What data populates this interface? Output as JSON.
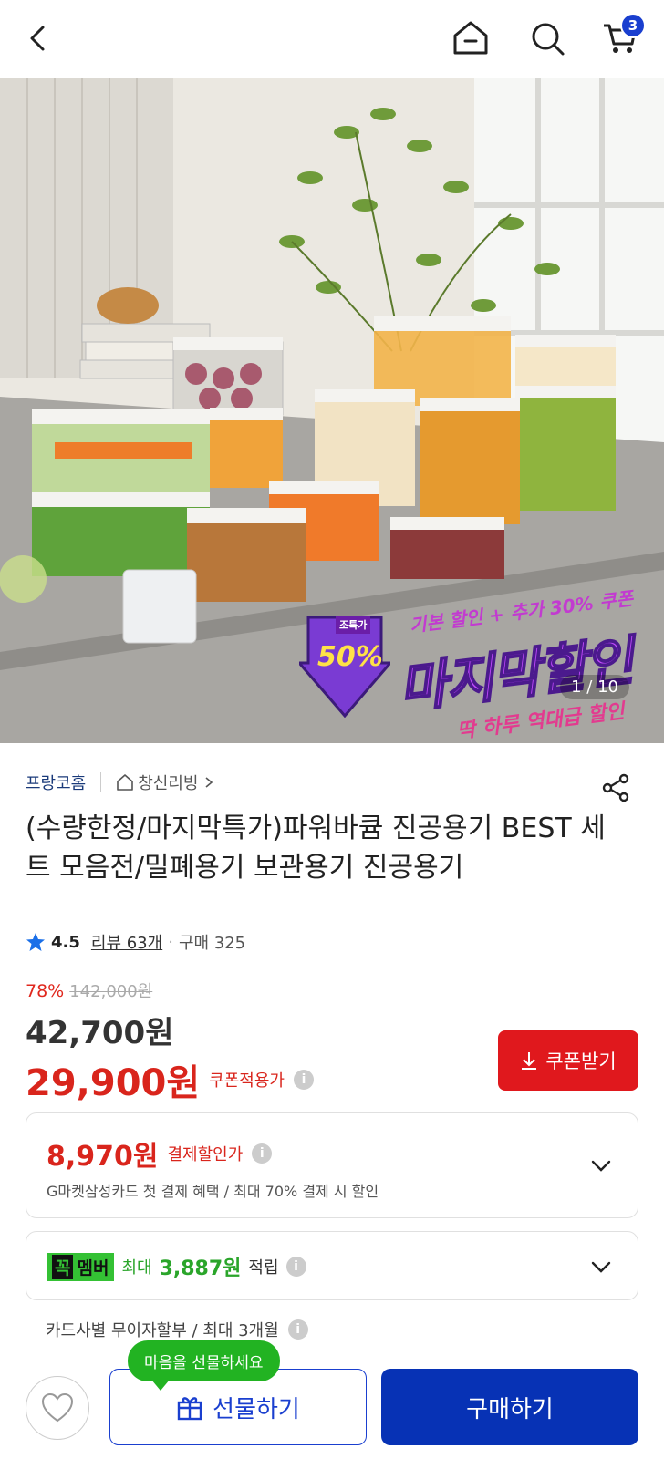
{
  "header": {
    "back_icon": "chevron-left-icon",
    "home_icon": "home-icon",
    "search_icon": "search-icon",
    "cart_icon": "cart-icon",
    "cart_count": "3"
  },
  "hero": {
    "promo_subtitle": "기본 할인 + 추가 30% 쿠폰",
    "promo_title": "마지막할인",
    "promo_bottom": "딱 하루 역대급 할인",
    "badge_top": "조특가",
    "badge_percent": "50%",
    "pager": "1 / 10"
  },
  "product": {
    "brand": "프랑코홈",
    "store": "창신리빙",
    "title": "(수량한정/마지막특가)파워바큠 진공용기 BEST 세트 모음전/밀폐용기 보관용기 진공용기",
    "rating": "4.5",
    "review": "리뷰 63개",
    "purchases": "구매 325",
    "discount_rate": "78%",
    "original_price": "142,000원",
    "price": "42,700원",
    "coupon_price": "29,900원",
    "coupon_price_label": "쿠폰적용가",
    "coupon_button": "쿠폰받기",
    "rating_color": "#1a6fe8"
  },
  "payment_discount": {
    "price": "8,970원",
    "label": "결제할인가",
    "description": "G마켓삼성카드 첫 결제 혜택 / 최대 70% 결제 시 할인"
  },
  "membership": {
    "badge_k": "꼭",
    "badge_label": "멤버",
    "prefix": "최대",
    "points": "3,887원",
    "suffix": "적립"
  },
  "installment": "카드사별 무이자할부 / 최대 3개월",
  "bottom_bar": {
    "tooltip": "마음을 선물하세요",
    "gift_label": "선물하기",
    "buy_label": "구매하기",
    "accent": "#0732b5"
  }
}
